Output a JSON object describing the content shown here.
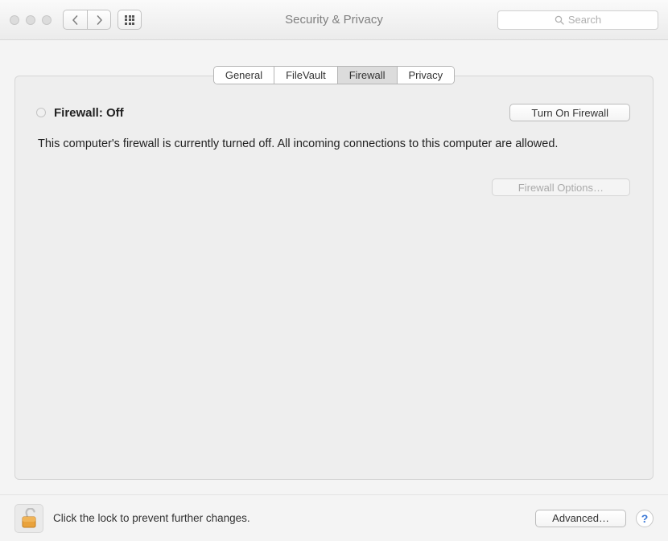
{
  "window": {
    "title": "Security & Privacy",
    "search_placeholder": "Search"
  },
  "tabs": [
    {
      "label": "General",
      "active": false
    },
    {
      "label": "FileVault",
      "active": false
    },
    {
      "label": "Firewall",
      "active": true
    },
    {
      "label": "Privacy",
      "active": false
    }
  ],
  "firewall": {
    "status_label": "Firewall: Off",
    "status_on": false,
    "turn_on_label": "Turn On Firewall",
    "description": "This computer's firewall is currently turned off. All incoming connections to this computer are allowed.",
    "options_label": "Firewall Options…",
    "options_enabled": false
  },
  "footer": {
    "lock_text": "Click the lock to prevent further changes.",
    "advanced_label": "Advanced…",
    "help_label": "?"
  }
}
